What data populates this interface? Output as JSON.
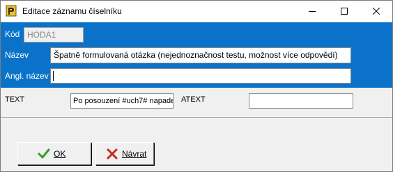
{
  "window": {
    "title": "Editace záznamu číselníku",
    "app_icon": "gold-keyboard-icon",
    "controls": {
      "minimize_icon": "minimize-icon",
      "maximize_icon": "maximize-icon",
      "close_icon": "close-icon"
    }
  },
  "colors": {
    "blue_panel": "#0a73c9",
    "gray_panel": "#f0f0f0",
    "ok_check": "#2e9e2e",
    "cancel_x": "#c8281e"
  },
  "form": {
    "kod": {
      "label": "Kód",
      "value": "HODA1",
      "disabled": true
    },
    "nazev": {
      "label": "Název",
      "value": "Špatně formulovaná otázka (nejednoznačnost testu, možnost více odpovědí)"
    },
    "angl_nazev": {
      "label": "Angl. název",
      "value": ""
    },
    "text": {
      "label": "TEXT",
      "value": "Po posouzení #uch7# napade"
    },
    "atext": {
      "label": "ATEXT",
      "value": ""
    }
  },
  "buttons": {
    "ok": {
      "label": "OK",
      "icon": "checkmark-icon"
    },
    "back": {
      "label": "Návrat",
      "icon": "cancel-x-icon"
    }
  }
}
